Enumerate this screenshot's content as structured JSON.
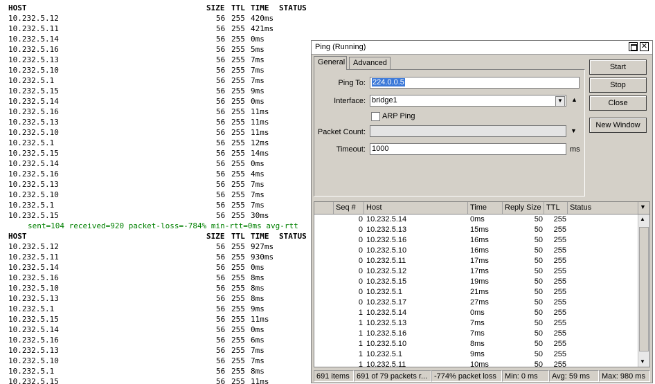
{
  "terminal": {
    "header": {
      "host": "HOST",
      "size": "SIZE",
      "ttl": "TTL",
      "time": "TIME",
      "status": "STATUS"
    },
    "block1": [
      {
        "host": "10.232.5.12",
        "size": "56",
        "ttl": "255",
        "time": "420ms"
      },
      {
        "host": "10.232.5.11",
        "size": "56",
        "ttl": "255",
        "time": "421ms"
      },
      {
        "host": "10.232.5.14",
        "size": "56",
        "ttl": "255",
        "time": "0ms"
      },
      {
        "host": "10.232.5.16",
        "size": "56",
        "ttl": "255",
        "time": "5ms"
      },
      {
        "host": "10.232.5.13",
        "size": "56",
        "ttl": "255",
        "time": "7ms"
      },
      {
        "host": "10.232.5.10",
        "size": "56",
        "ttl": "255",
        "time": "7ms"
      },
      {
        "host": "10.232.5.1",
        "size": "56",
        "ttl": "255",
        "time": "7ms"
      },
      {
        "host": "10.232.5.15",
        "size": "56",
        "ttl": "255",
        "time": "9ms"
      },
      {
        "host": "10.232.5.14",
        "size": "56",
        "ttl": "255",
        "time": "0ms"
      },
      {
        "host": "10.232.5.16",
        "size": "56",
        "ttl": "255",
        "time": "11ms"
      },
      {
        "host": "10.232.5.13",
        "size": "56",
        "ttl": "255",
        "time": "11ms"
      },
      {
        "host": "10.232.5.10",
        "size": "56",
        "ttl": "255",
        "time": "11ms"
      },
      {
        "host": "10.232.5.1",
        "size": "56",
        "ttl": "255",
        "time": "12ms"
      },
      {
        "host": "10.232.5.15",
        "size": "56",
        "ttl": "255",
        "time": "14ms"
      },
      {
        "host": "10.232.5.14",
        "size": "56",
        "ttl": "255",
        "time": "0ms"
      },
      {
        "host": "10.232.5.16",
        "size": "56",
        "ttl": "255",
        "time": "4ms"
      },
      {
        "host": "10.232.5.13",
        "size": "56",
        "ttl": "255",
        "time": "7ms"
      },
      {
        "host": "10.232.5.10",
        "size": "56",
        "ttl": "255",
        "time": "7ms"
      },
      {
        "host": "10.232.5.1",
        "size": "56",
        "ttl": "255",
        "time": "7ms"
      },
      {
        "host": "10.232.5.15",
        "size": "56",
        "ttl": "255",
        "time": "30ms"
      }
    ],
    "summary": "sent=104 received=920 packet-loss=-784% min-rtt=0ms avg-rtt",
    "block2": [
      {
        "host": "10.232.5.12",
        "size": "56",
        "ttl": "255",
        "time": "927ms"
      },
      {
        "host": "10.232.5.11",
        "size": "56",
        "ttl": "255",
        "time": "930ms"
      },
      {
        "host": "10.232.5.14",
        "size": "56",
        "ttl": "255",
        "time": "0ms"
      },
      {
        "host": "10.232.5.16",
        "size": "56",
        "ttl": "255",
        "time": "8ms"
      },
      {
        "host": "10.232.5.10",
        "size": "56",
        "ttl": "255",
        "time": "8ms"
      },
      {
        "host": "10.232.5.13",
        "size": "56",
        "ttl": "255",
        "time": "8ms"
      },
      {
        "host": "10.232.5.1",
        "size": "56",
        "ttl": "255",
        "time": "9ms"
      },
      {
        "host": "10.232.5.15",
        "size": "56",
        "ttl": "255",
        "time": "11ms"
      },
      {
        "host": "10.232.5.14",
        "size": "56",
        "ttl": "255",
        "time": "0ms"
      },
      {
        "host": "10.232.5.16",
        "size": "56",
        "ttl": "255",
        "time": "6ms"
      },
      {
        "host": "10.232.5.13",
        "size": "56",
        "ttl": "255",
        "time": "7ms"
      },
      {
        "host": "10.232.5.10",
        "size": "56",
        "ttl": "255",
        "time": "7ms"
      },
      {
        "host": "10.232.5.1",
        "size": "56",
        "ttl": "255",
        "time": "8ms"
      },
      {
        "host": "10.232.5.15",
        "size": "56",
        "ttl": "255",
        "time": "11ms"
      }
    ]
  },
  "window": {
    "title": "Ping (Running)",
    "tabs": {
      "general": "General",
      "advanced": "Advanced"
    },
    "form": {
      "ping_to_label": "Ping To:",
      "ping_to_value": "224.0.0.5",
      "interface_label": "Interface:",
      "interface_value": "bridge1",
      "arp_ping_label": "ARP Ping",
      "packet_count_label": "Packet Count:",
      "packet_count_value": "",
      "timeout_label": "Timeout:",
      "timeout_value": "1000",
      "timeout_unit": "ms"
    },
    "buttons": {
      "start": "Start",
      "stop": "Stop",
      "close": "Close",
      "new_window": "New Window"
    },
    "table": {
      "columns": [
        "Seq #",
        "Host",
        "Time",
        "Reply Size",
        "TTL",
        "Status"
      ],
      "rows": [
        {
          "seq": "0",
          "host": "10.232.5.14",
          "time": "0ms",
          "size": "50",
          "ttl": "255"
        },
        {
          "seq": "0",
          "host": "10.232.5.13",
          "time": "15ms",
          "size": "50",
          "ttl": "255"
        },
        {
          "seq": "0",
          "host": "10.232.5.16",
          "time": "16ms",
          "size": "50",
          "ttl": "255"
        },
        {
          "seq": "0",
          "host": "10.232.5.10",
          "time": "16ms",
          "size": "50",
          "ttl": "255"
        },
        {
          "seq": "0",
          "host": "10.232.5.11",
          "time": "17ms",
          "size": "50",
          "ttl": "255"
        },
        {
          "seq": "0",
          "host": "10.232.5.12",
          "time": "17ms",
          "size": "50",
          "ttl": "255"
        },
        {
          "seq": "0",
          "host": "10.232.5.15",
          "time": "19ms",
          "size": "50",
          "ttl": "255"
        },
        {
          "seq": "0",
          "host": "10.232.5.1",
          "time": "21ms",
          "size": "50",
          "ttl": "255"
        },
        {
          "seq": "0",
          "host": "10.232.5.17",
          "time": "27ms",
          "size": "50",
          "ttl": "255"
        },
        {
          "seq": "1",
          "host": "10.232.5.14",
          "time": "0ms",
          "size": "50",
          "ttl": "255"
        },
        {
          "seq": "1",
          "host": "10.232.5.13",
          "time": "7ms",
          "size": "50",
          "ttl": "255"
        },
        {
          "seq": "1",
          "host": "10.232.5.16",
          "time": "7ms",
          "size": "50",
          "ttl": "255"
        },
        {
          "seq": "1",
          "host": "10.232.5.10",
          "time": "8ms",
          "size": "50",
          "ttl": "255"
        },
        {
          "seq": "1",
          "host": "10.232.5.1",
          "time": "9ms",
          "size": "50",
          "ttl": "255"
        },
        {
          "seq": "1",
          "host": "10.232.5.11",
          "time": "10ms",
          "size": "50",
          "ttl": "255"
        }
      ]
    },
    "status": {
      "items": "691 items",
      "packets": "691 of 79 packets r...",
      "loss": "-774% packet loss",
      "min": "Min: 0 ms",
      "avg": "Avg: 59 ms",
      "max": "Max: 980 ms"
    }
  }
}
